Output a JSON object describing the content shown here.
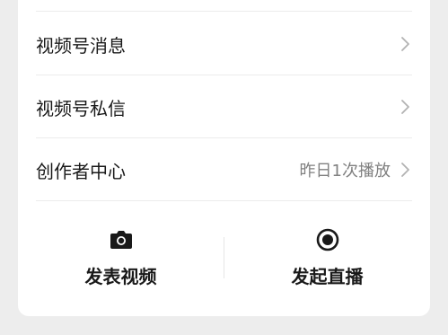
{
  "menu": {
    "items": [
      {
        "label": "视频号消息",
        "value": ""
      },
      {
        "label": "视频号私信",
        "value": ""
      },
      {
        "label": "创作者中心",
        "value": "昨日1次播放"
      }
    ]
  },
  "actions": {
    "publish_video": {
      "label": "发表视频",
      "icon": "camera-icon"
    },
    "start_live": {
      "label": "发起直播",
      "icon": "live-record-icon"
    }
  },
  "colors": {
    "background": "#ededed",
    "card": "#ffffff",
    "text": "#191919",
    "secondary_text": "#808080",
    "chevron": "#b2b2b2"
  }
}
